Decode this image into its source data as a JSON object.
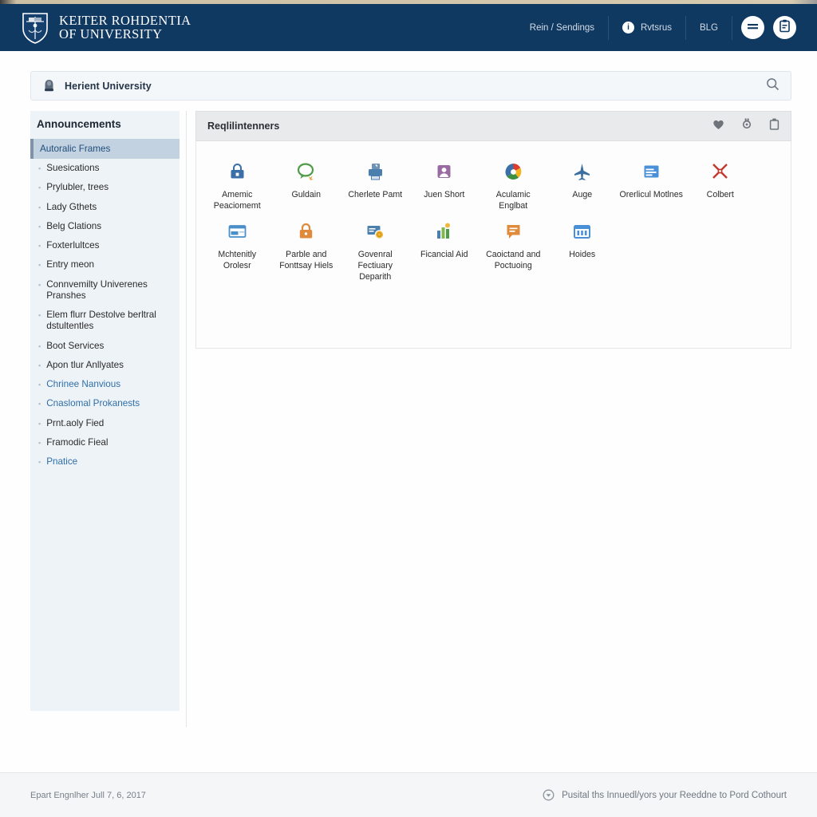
{
  "header": {
    "logo_icon": "university-crest-shield-icon",
    "brand_line1": "KEITER ROHDENTIA",
    "brand_line2": "OF UNIVERSITY",
    "nav": [
      {
        "label": "Rein / Sendings",
        "icon": null
      },
      {
        "label": "Rvtsrus",
        "icon": "info-circle-icon"
      },
      {
        "label": "BLG",
        "icon": null
      }
    ],
    "buttons": [
      {
        "name": "menu-button",
        "icon": "menu-lines-icon"
      },
      {
        "name": "clipboard-button",
        "icon": "clipboard-icon"
      }
    ]
  },
  "search": {
    "icon": "shield-bell-icon",
    "value": "Herient University",
    "placeholder": "Herient University",
    "search_icon": "search-icon"
  },
  "sidebar": {
    "title": "Announcements",
    "selected": "Autoralic Frames",
    "items": [
      {
        "label": "Suesications",
        "link": false
      },
      {
        "label": "Prylubler, trees",
        "link": false
      },
      {
        "label": "Lady Gthets",
        "link": false
      },
      {
        "label": "Belg Clations",
        "link": false
      },
      {
        "label": "Foxterlultces",
        "link": false
      },
      {
        "label": "Entry meon",
        "link": false
      },
      {
        "label": "Connvemilty Univerenes Pranshes",
        "link": false
      },
      {
        "label": "Elem flurr Destolve berltral dstultentles",
        "link": false
      },
      {
        "label": "Boot Services",
        "link": false
      },
      {
        "label": "Apon tlur Anllyates",
        "link": false
      },
      {
        "label": "Chrinee Nanvious",
        "link": true
      },
      {
        "label": "Cnaslomal Prokanests",
        "link": true
      },
      {
        "label": "Prnt.aoly Fied",
        "link": false
      },
      {
        "label": "Framodic Fieal",
        "link": false
      },
      {
        "label": "Pnatice",
        "link": true
      }
    ]
  },
  "panel": {
    "title": "Reqlilintenners",
    "head_icons": [
      {
        "name": "heart-icon"
      },
      {
        "name": "settings-icon"
      },
      {
        "name": "trash-icon"
      }
    ],
    "tiles_row1": [
      {
        "label": "Amemic Peaciomemt",
        "icon": "blue-lock-briefcase-icon",
        "color": "#3b6fa8"
      },
      {
        "label": "Guldain",
        "icon": "green-speech-bubble-icon",
        "color": "#4e9c46"
      },
      {
        "label": "Cherlete Pamt",
        "icon": "blue-printer-icon",
        "color": "#4a7fae"
      },
      {
        "label": "Juen Short",
        "icon": "purple-person-card-icon",
        "color": "#9a6ba3"
      },
      {
        "label": "Aculamic Englbat",
        "icon": "multicolor-pie-icon",
        "color": "#e8702a"
      },
      {
        "label": "Auge",
        "icon": "blue-airplane-icon",
        "color": "#3c6e9f"
      },
      {
        "label": "Orerlicul Motlnes",
        "icon": "blue-document-window-icon",
        "color": "#4a90d9"
      },
      {
        "label": "Colbert",
        "icon": "red-cross-swords-icon",
        "color": "#c0392b"
      }
    ],
    "tiles_row2": [
      {
        "label": "Mchtenitly Orolesr",
        "icon": "blue-card-window-icon",
        "color": "#4a8fc7"
      },
      {
        "label": "Parble and Fonttsay Hiels",
        "icon": "orange-lock-icon",
        "color": "#e08a3c"
      },
      {
        "label": "Govenral Fectiuary Deparith",
        "icon": "blue-card-coin-icon",
        "color": "#4a7fae"
      },
      {
        "label": "Ficancial Aid",
        "icon": "green-bar-chart-icon",
        "color": "#4e9c46"
      },
      {
        "label": "Caoictand and Poctuoing",
        "icon": "orange-note-icon",
        "color": "#e08a3c"
      },
      {
        "label": "Hoides",
        "icon": "blue-calendar-icon",
        "color": "#4a90d9"
      }
    ]
  },
  "footer": {
    "left": "Epart Engnlher Jull 7, 6, 2017",
    "right_icon": "circle-arrow-down-icon",
    "right": "Pusital ths Innuedl/yors your Reeddne to Pord Cothourt"
  },
  "colors": {
    "header_navy": "#103962",
    "sidebar_bg": "#eef3f8",
    "selected_bg": "#c3d2e1",
    "link_blue": "#2f6fa8",
    "panel_head": "#e9eaec"
  }
}
